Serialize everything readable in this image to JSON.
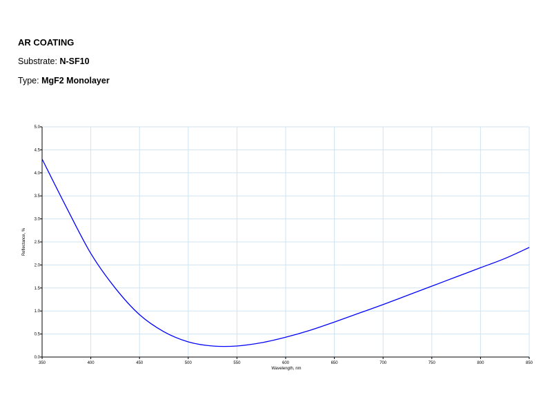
{
  "header": {
    "title": "AR COATING",
    "substrate_label": "Substrate:",
    "substrate_value": "N-SF10",
    "type_label": "Type:",
    "type_value": "MgF2 Monolayer"
  },
  "colors": {
    "line": "#0000ff",
    "grid": "#cfe3f2",
    "axis": "#000000"
  },
  "chart_data": {
    "type": "line",
    "title": "",
    "xlabel": "Wavelength, nm",
    "ylabel": "Reflectance, %",
    "xlim": [
      350,
      850
    ],
    "ylim": [
      0.0,
      5.0
    ],
    "grid": true,
    "x_ticks": [
      350,
      400,
      450,
      500,
      550,
      600,
      650,
      700,
      750,
      800,
      850
    ],
    "x_tick_labels": [
      "350",
      "400",
      "450",
      "500",
      "550",
      "600",
      "650",
      "700",
      "750",
      "800",
      "850"
    ],
    "y_ticks": [
      0.0,
      0.5,
      1.0,
      1.5,
      2.0,
      2.5,
      3.0,
      3.5,
      4.0,
      4.5,
      5.0
    ],
    "y_tick_labels": [
      "0.0",
      "0.5",
      "1.0",
      "1.5",
      "2.0",
      "2.5",
      "3.0",
      "3.5",
      "4.0",
      "4.5",
      "5.0"
    ],
    "series": [
      {
        "x": [
          350,
          375,
          400,
          425,
          450,
          475,
          500,
          525,
          550,
          575,
          600,
          625,
          650,
          675,
          700,
          725,
          750,
          775,
          800,
          825,
          850
        ],
        "y": [
          4.3,
          3.25,
          2.25,
          1.5,
          0.92,
          0.55,
          0.33,
          0.24,
          0.24,
          0.31,
          0.43,
          0.58,
          0.76,
          0.95,
          1.14,
          1.34,
          1.54,
          1.74,
          1.94,
          2.14,
          2.38
        ]
      }
    ]
  }
}
